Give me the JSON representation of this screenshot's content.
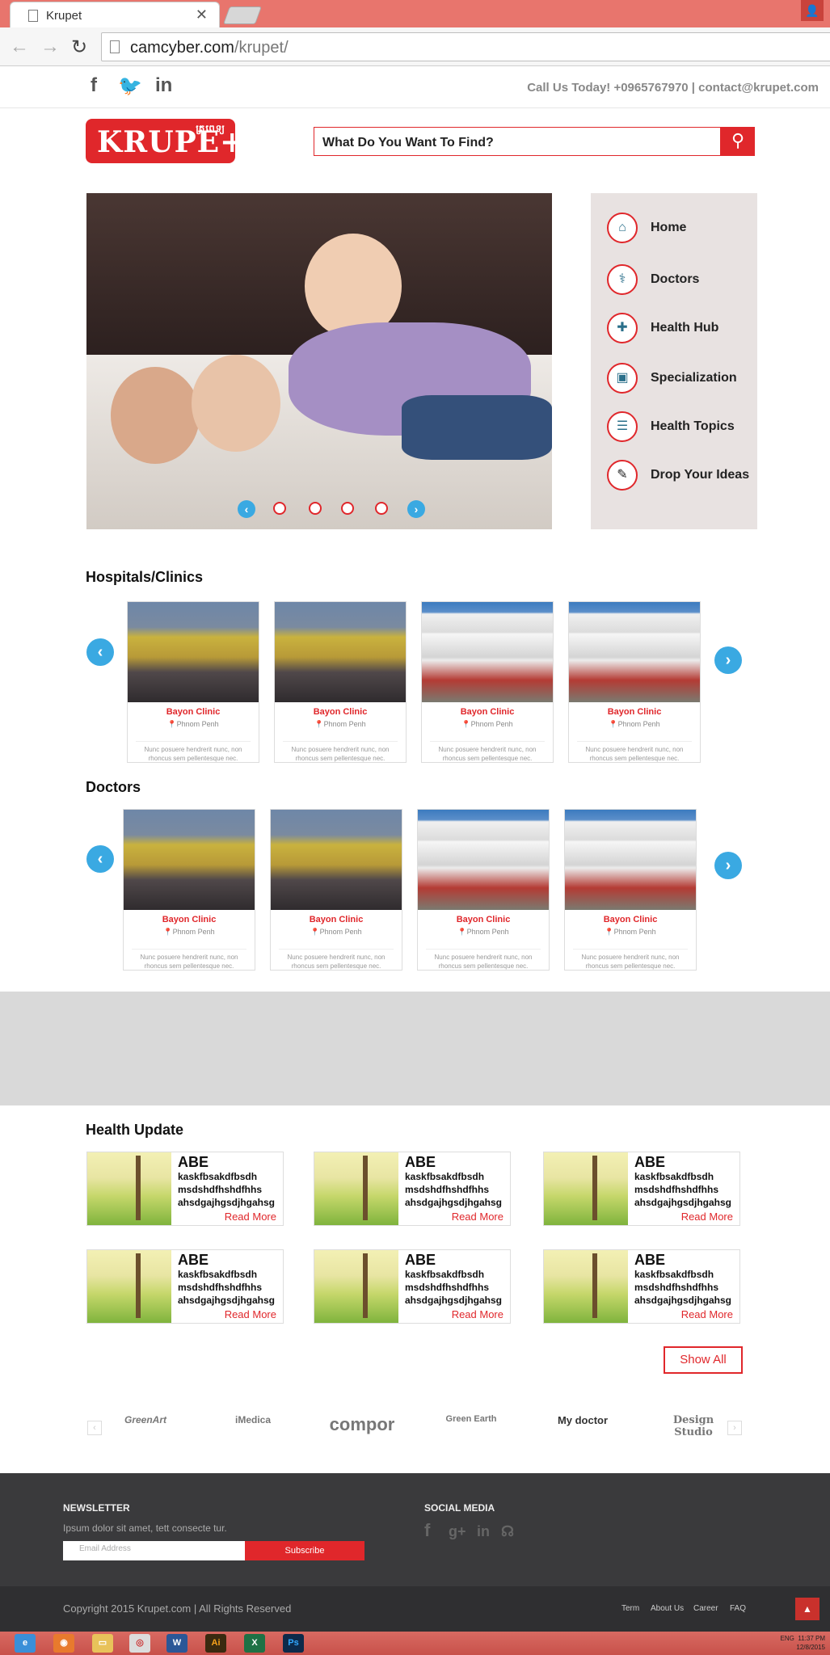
{
  "browser": {
    "tab_title": "Krupet",
    "url_domain": "camcyber.com",
    "url_path": "/krupet/"
  },
  "topbar": {
    "social": [
      "f",
      "t",
      "in"
    ],
    "contact": "Call Us Today! +0965767970 | contact@krupet.com"
  },
  "header": {
    "logo_text": "KRUPE+",
    "logo_khmer": "គ្រូពេទ្យ",
    "search_placeholder": "What Do You Want To Find?"
  },
  "menu": [
    {
      "label": "Home",
      "icon": "home-icon"
    },
    {
      "label": "Doctors",
      "icon": "doctors-icon"
    },
    {
      "label": "Health Hub",
      "icon": "health-hub-icon"
    },
    {
      "label": "Specialization",
      "icon": "specialization-icon"
    },
    {
      "label": "Health Topics",
      "icon": "health-topics-icon"
    },
    {
      "label": "Drop Your Ideas",
      "icon": "ideas-icon"
    }
  ],
  "sections": {
    "hospitals_title": "Hospitals/Clinics",
    "doctors_title": "Doctors",
    "health_title": "Health Update"
  },
  "hospitals": [
    {
      "name": "Bayon Clinic",
      "location": "Phnom Penh",
      "desc": "Nunc posuere hendrerit nunc, non rhoncus sem pellentesque nec."
    },
    {
      "name": "Bayon Clinic",
      "location": "Phnom Penh",
      "desc": "Nunc posuere hendrerit nunc, non rhoncus sem pellentesque nec."
    },
    {
      "name": "Bayon Clinic",
      "location": "Phnom Penh",
      "desc": "Nunc posuere hendrerit nunc, non rhoncus sem pellentesque nec."
    },
    {
      "name": "Bayon Clinic",
      "location": "Phnom Penh",
      "desc": "Nunc posuere hendrerit nunc, non rhoncus sem pellentesque nec."
    }
  ],
  "doctors": [
    {
      "name": "Bayon Clinic",
      "location": "Phnom Penh",
      "desc": "Nunc posuere hendrerit nunc, non rhoncus sem pellentesque nec."
    },
    {
      "name": "Bayon Clinic",
      "location": "Phnom Penh",
      "desc": "Nunc posuere hendrerit nunc, non rhoncus sem pellentesque nec."
    },
    {
      "name": "Bayon Clinic",
      "location": "Phnom Penh",
      "desc": "Nunc posuere hendrerit nunc, non rhoncus sem pellentesque nec."
    },
    {
      "name": "Bayon Clinic",
      "location": "Phnom Penh",
      "desc": "Nunc posuere hendrerit nunc, non rhoncus sem pellentesque nec."
    }
  ],
  "health_updates": [
    {
      "title": "ABE",
      "line1": "kaskfbsakdfbsdh",
      "line2": "msdshdfhshdfhhs",
      "line3": "ahsdgajhgsdjhgahsg",
      "more": "Read More"
    },
    {
      "title": "ABE",
      "line1": "kaskfbsakdfbsdh",
      "line2": "msdshdfhshdfhhs",
      "line3": "ahsdgajhgsdjhgahsg",
      "more": "Read More"
    },
    {
      "title": "ABE",
      "line1": "kaskfbsakdfbsdh",
      "line2": "msdshdfhshdfhhs",
      "line3": "ahsdgajhgsdjhgahsg",
      "more": "Read More"
    },
    {
      "title": "ABE",
      "line1": "kaskfbsakdfbsdh",
      "line2": "msdshdfhshdfhhs",
      "line3": "ahsdgajhgsdjhgahsg",
      "more": "Read More"
    },
    {
      "title": "ABE",
      "line1": "kaskfbsakdfbsdh",
      "line2": "msdshdfhshdfhhs",
      "line3": "ahsdgajhgsdjhgahsg",
      "more": "Read More"
    },
    {
      "title": "ABE",
      "line1": "kaskfbsakdfbsdh",
      "line2": "msdshdfhshdfhhs",
      "line3": "ahsdgajhgsdjhgahsg",
      "more": "Read More"
    }
  ],
  "show_all": "Show All",
  "partners": [
    "GreenArt",
    "iMedica",
    "compor",
    "Green Earth",
    "My doctor",
    "Design Studio"
  ],
  "footer": {
    "newsletter_title": "NEWSLETTER",
    "newsletter_text": "Ipsum dolor sit amet, tett consecte tur.",
    "email_placeholder": "Email Address",
    "subscribe": "Subscribe",
    "social_title": "SOCIAL MEDIA",
    "copyright": "Copyright 2015 Krupet.com | All Rights Reserved",
    "links": [
      "Term",
      "About Us",
      "Career",
      "FAQ"
    ]
  },
  "taskbar": {
    "time": "11:37 PM",
    "date": "12/8/2015",
    "lang": "ENG"
  },
  "colors": {
    "accent": "#e0272b",
    "arrow": "#3aa9e2",
    "footer": "#3a3a3c"
  }
}
